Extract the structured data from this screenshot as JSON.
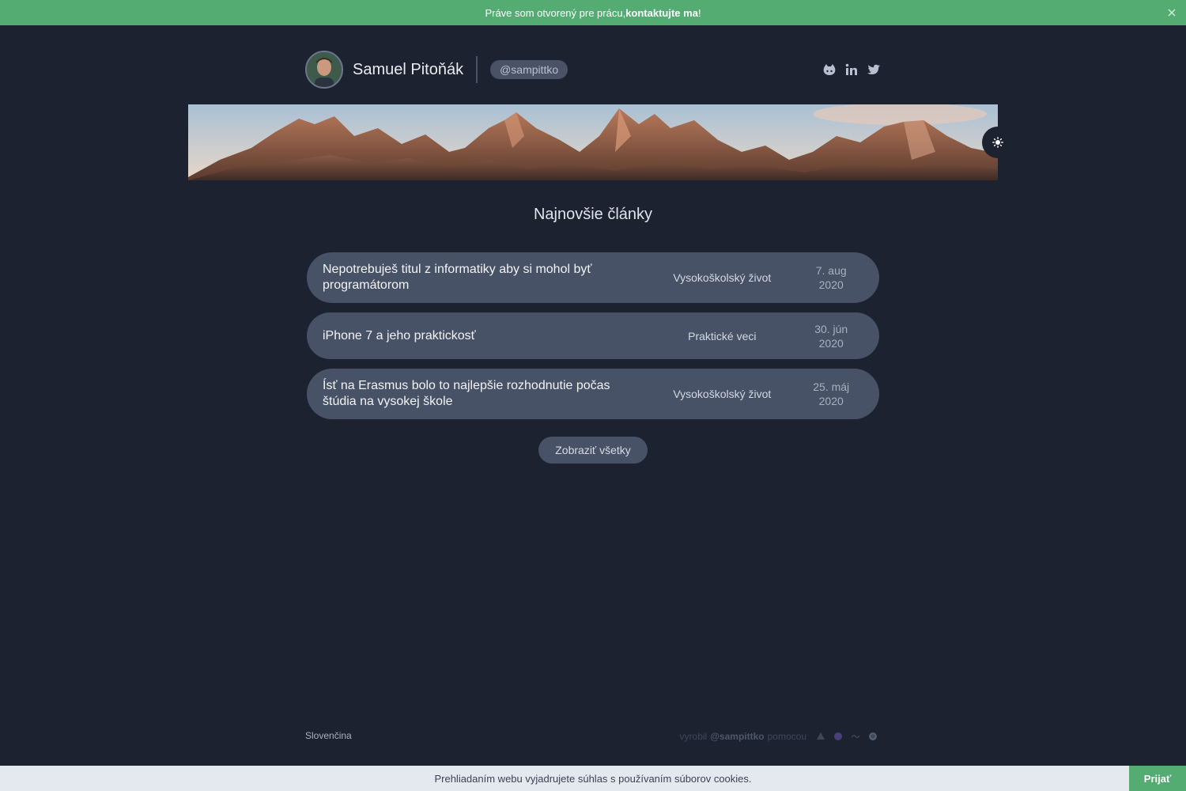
{
  "banner": {
    "text_before": "Práve som otvorený pre prácu, ",
    "link": "kontaktujte ma",
    "text_after": "!",
    "close_icon": "close-icon",
    "color": "#54ac72"
  },
  "header": {
    "name": "Samuel Pitoňák",
    "handle": "@sampittko",
    "socials": [
      "github-icon",
      "linkedin-icon",
      "twitter-icon"
    ]
  },
  "hero": {
    "theme_toggle_icon": "sun-icon"
  },
  "main": {
    "section_title": "Najnovšie články",
    "articles": [
      {
        "title": "Nepotrebuješ titul z informatiky aby si mohol byť programátorom",
        "category": "Vysokoškolský život",
        "date_day": "7. aug",
        "date_year": "2020"
      },
      {
        "title": "iPhone 7 a jeho praktickosť",
        "category": "Praktické veci",
        "date_day": "30. jún",
        "date_year": "2020"
      },
      {
        "title": "Ísť na Erasmus bolo to najlepšie rozhodnutie počas štúdia na vysokej škole",
        "category": "Vysokoškolský život",
        "date_day": "25. máj",
        "date_year": "2020"
      }
    ],
    "show_all": "Zobraziť všetky"
  },
  "footer": {
    "language": "Slovenčina",
    "credit_prefix": "vyrobil",
    "credit_author": "@sampittko",
    "credit_suffix": "pomocou"
  },
  "cookies": {
    "text": "Prehliadaním webu vyjadrujete súhlas s používaním súborov cookies.",
    "accept": "Prijať"
  }
}
